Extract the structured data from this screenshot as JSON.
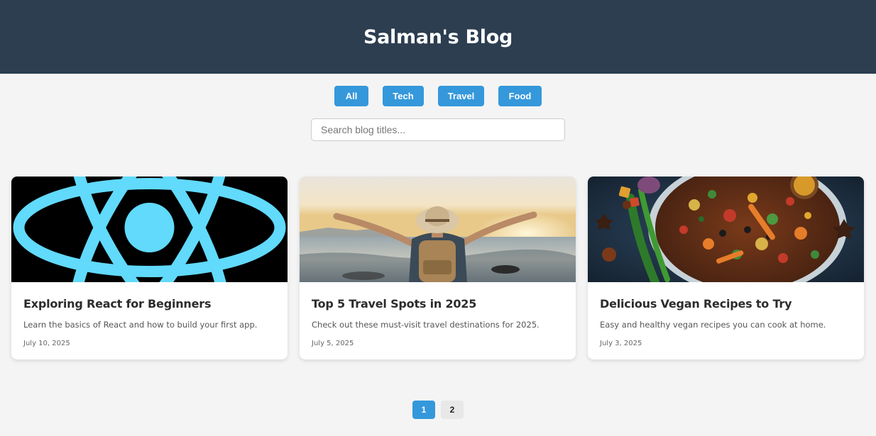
{
  "header": {
    "title": "Salman's Blog"
  },
  "filters": [
    {
      "label": "All"
    },
    {
      "label": "Tech"
    },
    {
      "label": "Travel"
    },
    {
      "label": "Food"
    }
  ],
  "search": {
    "placeholder": "Search blog titles...",
    "value": ""
  },
  "posts": [
    {
      "title": "Exploring React for Beginners",
      "description": "Learn the basics of React and how to build your first app.",
      "date": "July 10, 2025",
      "image": "react-logo-image"
    },
    {
      "title": "Top 5 Travel Spots in 2025",
      "description": "Check out these must-visit travel destinations for 2025.",
      "date": "July 5, 2025",
      "image": "traveler-beach-image"
    },
    {
      "title": "Delicious Vegan Recipes to Try",
      "description": "Easy and healthy vegan recipes you can cook at home.",
      "date": "July 3, 2025",
      "image": "vegan-food-bowl-image"
    }
  ],
  "pagination": {
    "pages": [
      "1",
      "2"
    ],
    "current": "1"
  },
  "colors": {
    "header_bg": "#2c3e50",
    "accent": "#3498db",
    "page_bg": "#f4f4f4",
    "react_blue": "#61dafb"
  }
}
